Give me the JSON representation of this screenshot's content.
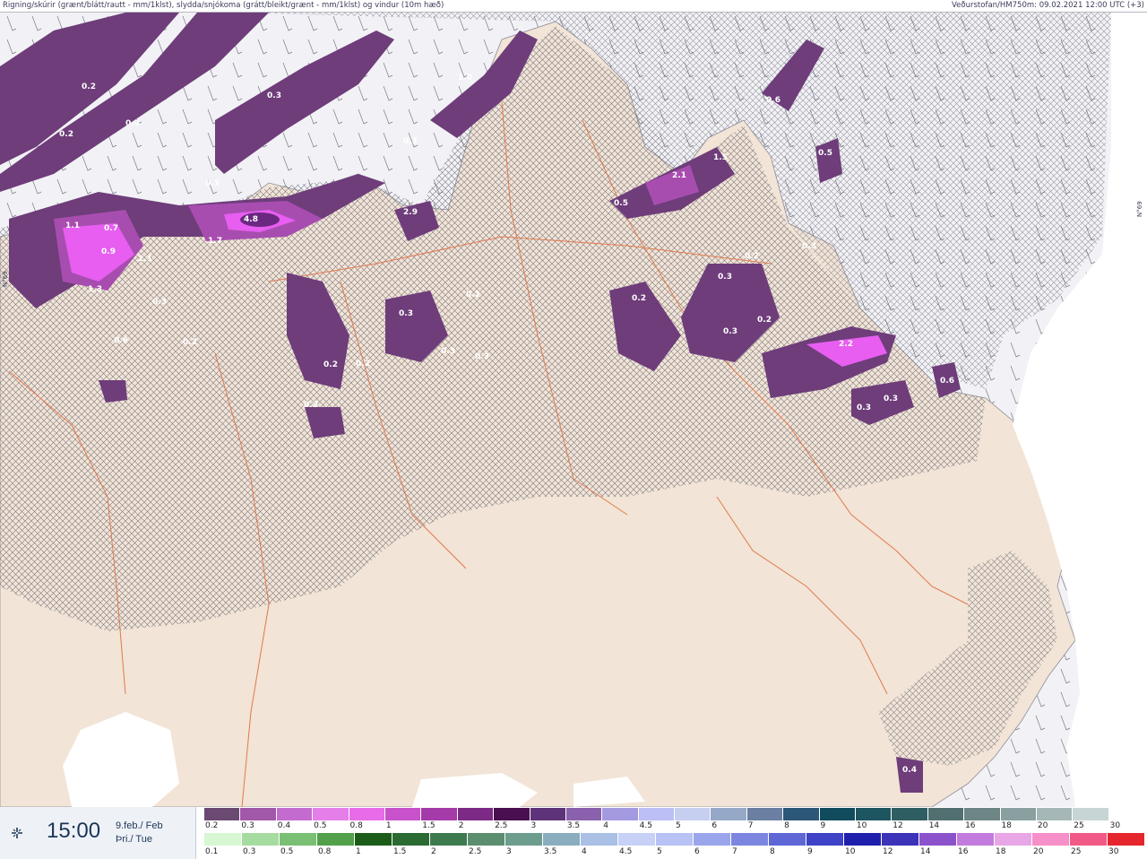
{
  "header": {
    "title": "Rigning/skúrir (grænt/blátt/rautt - mm/1klst), slydda/snjókoma (grátt/bleikt/grænt - mm/1klst) og vindur (10m hæð)",
    "source": "Veðurstofan/HM750m: 09.02.2021 12:00 UTC (+3)"
  },
  "map": {
    "lat_label_left": "N°69",
    "lat_label_right": "N°69",
    "precip_labels": [
      {
        "id": "p1",
        "text": "0.2"
      },
      {
        "id": "p2",
        "text": "0.3"
      },
      {
        "id": "p3",
        "text": "0.4"
      },
      {
        "id": "p4",
        "text": "0.2"
      },
      {
        "id": "p5",
        "text": "0.3"
      },
      {
        "id": "p6",
        "text": "0.3"
      },
      {
        "id": "p7",
        "text": "1.0"
      },
      {
        "id": "p8",
        "text": "1.1"
      },
      {
        "id": "p9",
        "text": "0.7"
      },
      {
        "id": "p10",
        "text": "0.9"
      },
      {
        "id": "p11",
        "text": "2.1"
      },
      {
        "id": "p12",
        "text": "1.3"
      },
      {
        "id": "p13",
        "text": "0.3"
      },
      {
        "id": "p14",
        "text": "0.6"
      },
      {
        "id": "p15",
        "text": "0.2"
      },
      {
        "id": "p16",
        "text": "1.7"
      },
      {
        "id": "p17",
        "text": "4.8"
      },
      {
        "id": "p18",
        "text": "2.9"
      },
      {
        "id": "p19",
        "text": "0.3"
      },
      {
        "id": "p20",
        "text": "0.2"
      },
      {
        "id": "p21",
        "text": "0.3"
      },
      {
        "id": "p22",
        "text": "0.2"
      },
      {
        "id": "p23",
        "text": "0.3"
      },
      {
        "id": "p24",
        "text": "0.3"
      },
      {
        "id": "p25",
        "text": "0.5"
      },
      {
        "id": "p26",
        "text": "2.1"
      },
      {
        "id": "p27",
        "text": "1.5"
      },
      {
        "id": "p28",
        "text": "0.2"
      },
      {
        "id": "p29",
        "text": "0.3"
      },
      {
        "id": "p30",
        "text": "0.2"
      },
      {
        "id": "p31",
        "text": "0.3"
      },
      {
        "id": "p32",
        "text": "0.2"
      },
      {
        "id": "p33",
        "text": "2.2"
      },
      {
        "id": "p34",
        "text": "0.3"
      },
      {
        "id": "p35",
        "text": "0.3"
      },
      {
        "id": "p36",
        "text": "0.6"
      },
      {
        "id": "p37",
        "text": "0.6"
      },
      {
        "id": "p38",
        "text": "0.5"
      },
      {
        "id": "p39",
        "text": "0.4"
      },
      {
        "id": "p40",
        "text": "0.3"
      },
      {
        "id": "p41",
        "text": "0.2"
      }
    ],
    "colors": {
      "sea": "#f2f2f6",
      "land": "#f2e4d6",
      "roads": "#e07a4f",
      "hatch": "#6d6d78",
      "precip_light": "#6e3d7a",
      "precip_mid": "#a84db0",
      "precip_high": "#e75ef0",
      "precip_peak": "#f6a7f7"
    }
  },
  "footer": {
    "time": "15:00",
    "date_line1": "9.feb./ Feb",
    "date_line2": "Þri./ Tue",
    "scale_top": {
      "labels": [
        "0.2",
        "0.3",
        "0.4",
        "0.5",
        "0.8",
        "1",
        "1.5",
        "2",
        "2.5",
        "3",
        "3.5",
        "4",
        "4.5",
        "5",
        "6",
        "7",
        "8",
        "9",
        "10",
        "12",
        "14",
        "16",
        "18",
        "20",
        "25",
        "30"
      ],
      "colors": [
        "#6b4a72",
        "#a258a8",
        "#c46bd0",
        "#e57ee8",
        "#e86ce8",
        "#c752c9",
        "#a53aa9",
        "#7c2a85",
        "#4a0f4f",
        "#5e3379",
        "#8a61ad",
        "#a49ae0",
        "#bbbff6",
        "#c6cfef",
        "#96a8c8",
        "#6a7fa1",
        "#2c5777",
        "#114c5e",
        "#1d5560",
        "#2f5e62",
        "#526f70",
        "#6d8585",
        "#8aa0a0",
        "#a5b7b7",
        "#c7d5d5",
        "#ffffff"
      ]
    },
    "scale_bottom": {
      "labels": [
        "0.1",
        "0.3",
        "0.5",
        "0.8",
        "1",
        "1.5",
        "2",
        "2.5",
        "3",
        "3.5",
        "4",
        "4.5",
        "5",
        "6",
        "7",
        "8",
        "9",
        "10",
        "12",
        "14",
        "16",
        "18",
        "20",
        "25",
        "30"
      ],
      "colors": [
        "#d6f7d2",
        "#a7dca1",
        "#79c074",
        "#52a049",
        "#1c5c19",
        "#2a6b33",
        "#3e7a50",
        "#5b8e6e",
        "#6d9d8d",
        "#8aaebd",
        "#aac0e5",
        "#c7d0f6",
        "#b8c2f5",
        "#9ba5ec",
        "#7c86e0",
        "#5f66d5",
        "#3e42c6",
        "#1f1fae",
        "#3b33b8",
        "#8b52cc",
        "#c27bdc",
        "#e8a6e6",
        "#f78fc8",
        "#f15a86",
        "#e5262c"
      ]
    }
  }
}
